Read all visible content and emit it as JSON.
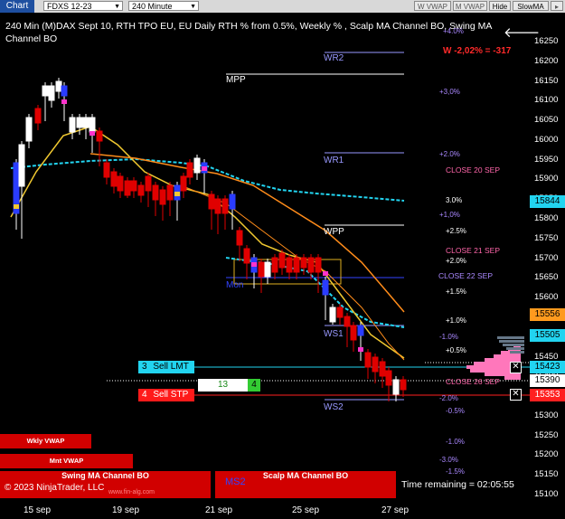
{
  "toolbar": {
    "chart_tab": "Chart",
    "instrument": "FDXS 12-23",
    "interval": "240 Minute",
    "buttons": [
      "W VWAP",
      "M VWAP",
      "Hide",
      "SlowMA"
    ]
  },
  "title": "240 Min (M)DAX Sept 10, RTH TPO EU, EU Daily RTH % from 0.5%, Weekly % , Scalp MA Channel BO, Swing MA Channel BO",
  "pnl": "W -2,02% = -317",
  "y_axis_ticks": [
    "16250",
    "16200",
    "16150",
    "16100",
    "16050",
    "16000",
    "15950",
    "15900",
    "15850",
    "15800",
    "15750",
    "15700",
    "15650",
    "15600",
    "15550",
    "15500",
    "15450",
    "15400",
    "15350",
    "15300",
    "15250",
    "15200",
    "15150",
    "15100"
  ],
  "x_axis_labels": [
    "15 sep",
    "19 sep",
    "21 sep",
    "25 sep",
    "27 sep"
  ],
  "price_flags": [
    {
      "value": "15844",
      "bg": "#22d4f0"
    },
    {
      "value": "15556",
      "bg": "#ff9a1e"
    },
    {
      "value": "15505",
      "bg": "#22d4f0"
    },
    {
      "value": "15423",
      "bg": "#22d4f0"
    },
    {
      "value": "15390",
      "bg": "#ffffff"
    },
    {
      "value": "15353",
      "bg": "#ff2020"
    }
  ],
  "levels": {
    "wr2": "WR2",
    "mpp": "MPP",
    "wr1": "WR1",
    "wpp": "WPP",
    "mon": "Mon",
    "ws1": "WS1",
    "ws2": "WS2",
    "ms2": "MS2"
  },
  "pct_labels": [
    "+4.0%",
    "+3,0%",
    "+2.0%",
    "3.0%",
    "+1,0%",
    "+2.5%",
    "+2.0%",
    "+1.5%",
    "+1.0%",
    "-1.0%",
    "+0.5%",
    "-2.0%",
    "-0.5%",
    "-1.0%",
    "-3.0%",
    "-1.5%"
  ],
  "close_labels": [
    "CLOSE 20 SEP",
    "CLOSE 21 SEP",
    "CLOSE 22 SEP",
    "CLOSE 26 SEP"
  ],
  "orders": {
    "sell_lmt_qty": "3",
    "sell_lmt_label": "Sell LMT",
    "position_qty": "13",
    "position_side": "4",
    "sell_stp_qty": "4",
    "sell_stp_label": "Sell STP"
  },
  "vwap": {
    "weekly": "Wkly VWAP",
    "monthly": "Mnt VWAP"
  },
  "legend": {
    "swing": "Swing MA Channel BO",
    "scalp": "Scalp MA Channel BO"
  },
  "watermark": "www.fin-alg.com",
  "copyright": "© 2023 NinjaTrader, LLC",
  "time_remaining": "Time remaining = 02:05:55",
  "colors": {
    "up": "#ffffff",
    "down": "#e00000",
    "cyan": "#22d4f0",
    "orange": "#ff8c1a",
    "yellow": "#f0c830",
    "blue": "#2a3cff",
    "magenta": "#ff33cc"
  }
}
